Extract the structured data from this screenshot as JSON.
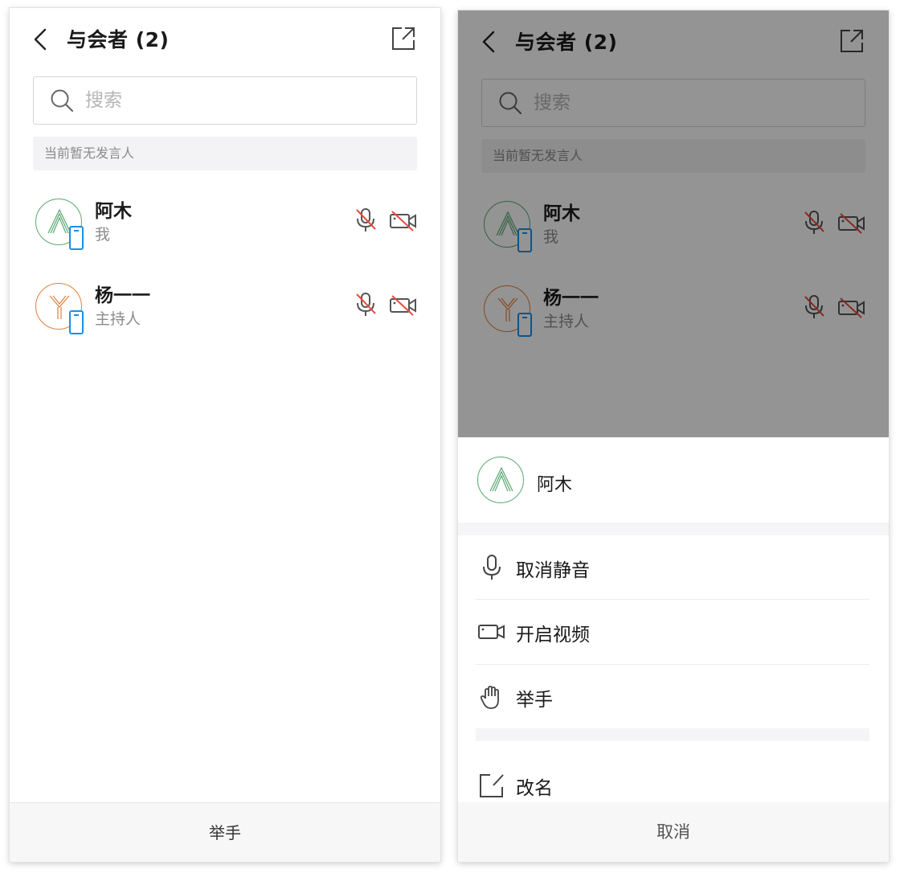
{
  "header": {
    "title": "与会者 (2)"
  },
  "search": {
    "placeholder": "搜索"
  },
  "notice": "当前暂无发言人",
  "participants": [
    {
      "name": "阿木",
      "role": "我",
      "avatar_letter": "A",
      "avatar_color": "#5aa872"
    },
    {
      "name": "杨一一",
      "role": "主持人",
      "avatar_letter": "Y",
      "avatar_color": "#e07f3a"
    }
  ],
  "footer": {
    "raise_hand": "举手"
  },
  "sheet": {
    "name": "阿木",
    "actions": [
      {
        "label": "取消静音",
        "icon": "microphone-icon"
      },
      {
        "label": "开启视频",
        "icon": "video-camera-icon"
      },
      {
        "label": "举手",
        "icon": "raise-hand-icon"
      }
    ],
    "rename": {
      "label": "改名",
      "icon": "edit-icon"
    },
    "cancel": "取消"
  },
  "colors": {
    "accent_blue": "#1a8fe8",
    "muted_icon_slash": "#e84b3c",
    "overlay": "rgba(0,0,0,0.42)"
  }
}
